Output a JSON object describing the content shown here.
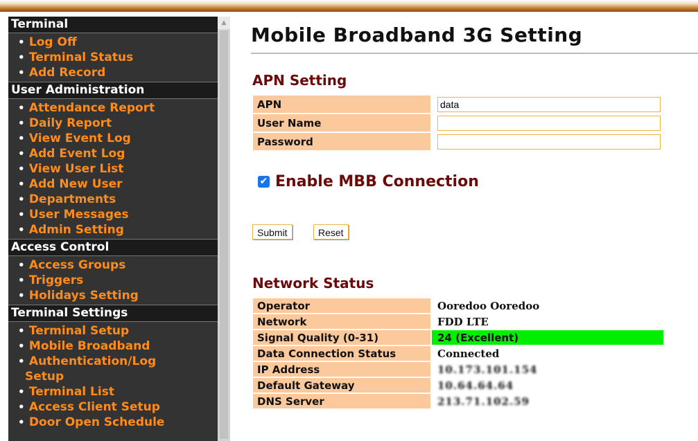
{
  "sidebar": {
    "sections": [
      {
        "title": "Terminal",
        "items": [
          "Log Off",
          "Terminal Status",
          "Add Record"
        ]
      },
      {
        "title": "User Administration",
        "items": [
          "Attendance Report",
          "Daily Report",
          "View Event Log",
          "Add Event Log",
          "View User List",
          "Add New User",
          "Departments",
          "User Messages",
          "Admin Setting"
        ]
      },
      {
        "title": "Access Control",
        "items": [
          "Access Groups",
          "Triggers",
          "Holidays Setting"
        ]
      },
      {
        "title": "Terminal Settings",
        "items": [
          "Terminal Setup",
          "Mobile Broadband",
          "Authentication/Log",
          "Terminal List",
          "Access Client Setup",
          "Door Open Schedule"
        ],
        "auth_log_continuation": "Setup"
      }
    ]
  },
  "page": {
    "title": "Mobile Broadband 3G Setting",
    "apn_heading": "APN Setting",
    "apn_label": "APN",
    "apn_value": "data",
    "username_label": "User Name",
    "username_value": "",
    "password_label": "Password",
    "password_value": "",
    "enable_label": "Enable MBB Connection",
    "enable_checked": true,
    "submit_label": "Submit",
    "reset_label": "Reset",
    "network_heading": "Network Status",
    "network": [
      {
        "label": "Operator",
        "value": "Ooredoo Ooredoo"
      },
      {
        "label": "Network",
        "value": "FDD LTE"
      },
      {
        "label": "Signal Quality (0-31)",
        "value": "24 (Excellent)"
      },
      {
        "label": "Data Connection Status",
        "value": "Connected"
      },
      {
        "label": "IP Address",
        "value": "10.173.101.154"
      },
      {
        "label": "Default Gateway",
        "value": "10.64.64.64"
      },
      {
        "label": "DNS Server",
        "value": "213.71.102.59"
      }
    ]
  },
  "colors": {
    "signal_good": "#00ee00",
    "label_bg": "#fcc99c",
    "heading": "#6b0a0a",
    "nav_link": "#ff8c1a"
  }
}
